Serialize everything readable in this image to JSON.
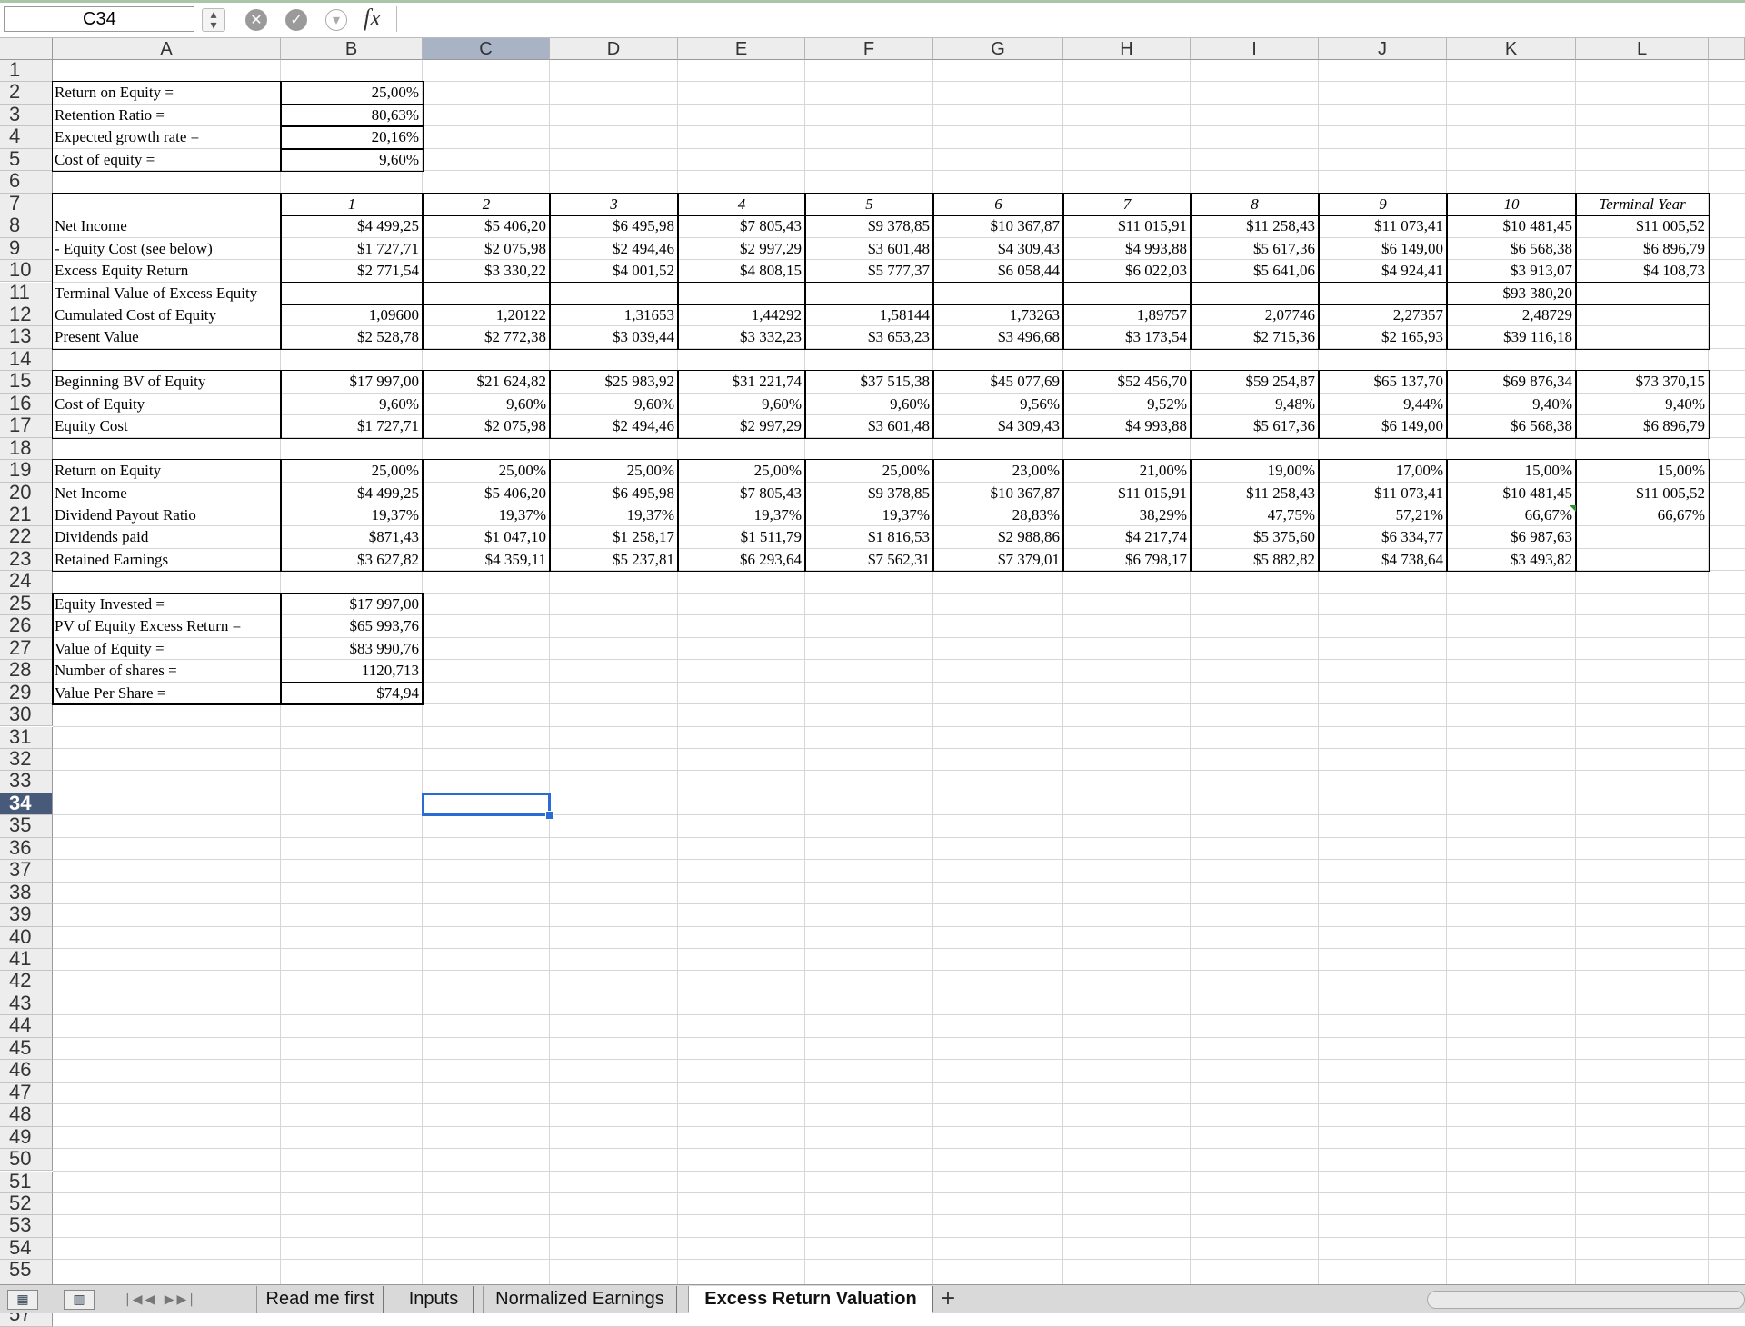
{
  "formula_bar": {
    "cell_ref": "C34",
    "fx": "fx",
    "formula": ""
  },
  "columns": [
    "A",
    "B",
    "C",
    "D",
    "E",
    "F",
    "G",
    "H",
    "I",
    "J",
    "K",
    "L"
  ],
  "selected_column": "C",
  "row_count": 57,
  "selected_row": 34,
  "assumptions": [
    {
      "label": "Return on Equity =",
      "value": "25,00%"
    },
    {
      "label": "Retention  Ratio =",
      "value": "80,63%"
    },
    {
      "label": "Expected growth rate =",
      "value": "20,16%"
    },
    {
      "label": "Cost of equity =",
      "value": "9,60%"
    }
  ],
  "years": [
    "1",
    "2",
    "3",
    "4",
    "5",
    "6",
    "7",
    "8",
    "9",
    "10",
    "Terminal Year"
  ],
  "table1": [
    {
      "label": "Net Income",
      "values": [
        "$4 499,25",
        "$5 406,20",
        "$6 495,98",
        "$7 805,43",
        "$9 378,85",
        "$10 367,87",
        "$11 015,91",
        "$11 258,43",
        "$11 073,41",
        "$10 481,45",
        "$11 005,52"
      ]
    },
    {
      "label": " - Equity Cost (see below)",
      "values": [
        "$1 727,71",
        "$2 075,98",
        "$2 494,46",
        "$2 997,29",
        "$3 601,48",
        "$4 309,43",
        "$4 993,88",
        "$5 617,36",
        "$6 149,00",
        "$6 568,38",
        "$6 896,79"
      ]
    },
    {
      "label": "Excess Equity Return",
      "values": [
        "$2 771,54",
        "$3 330,22",
        "$4 001,52",
        "$4 808,15",
        "$5 777,37",
        "$6 058,44",
        "$6 022,03",
        "$5 641,06",
        "$4 924,41",
        "$3 913,07",
        "$4 108,73"
      ]
    },
    {
      "label": "Terminal  Value of Excess Equity",
      "values": [
        "",
        "",
        "",
        "",
        "",
        "",
        "",
        "",
        "",
        "$93 380,20",
        ""
      ]
    },
    {
      "label": "Cumulated Cost of Equity",
      "values": [
        "1,09600",
        "1,20122",
        "1,31653",
        "1,44292",
        "1,58144",
        "1,73263",
        "1,89757",
        "2,07746",
        "2,27357",
        "2,48729",
        ""
      ]
    },
    {
      "label": "Present Value",
      "values": [
        "$2 528,78",
        "$2 772,38",
        "$3 039,44",
        "$3 332,23",
        "$3 653,23",
        "$3 496,68",
        "$3 173,54",
        "$2 715,36",
        "$2 165,93",
        "$39 116,18",
        ""
      ]
    }
  ],
  "table2": [
    {
      "label": "Beginning BV of Equity",
      "values": [
        "$17 997,00",
        "$21 624,82",
        "$25 983,92",
        "$31 221,74",
        "$37 515,38",
        "$45 077,69",
        "$52 456,70",
        "$59 254,87",
        "$65 137,70",
        "$69 876,34",
        "$73 370,15"
      ]
    },
    {
      "label": "Cost of Equity",
      "values": [
        "9,60%",
        "9,60%",
        "9,60%",
        "9,60%",
        "9,60%",
        "9,56%",
        "9,52%",
        "9,48%",
        "9,44%",
        "9,40%",
        "9,40%"
      ]
    },
    {
      "label": "Equity Cost",
      "values": [
        "$1 727,71",
        "$2 075,98",
        "$2 494,46",
        "$2 997,29",
        "$3 601,48",
        "$4 309,43",
        "$4 993,88",
        "$5 617,36",
        "$6 149,00",
        "$6 568,38",
        "$6 896,79"
      ]
    }
  ],
  "table3": [
    {
      "label": "Return on Equity",
      "values": [
        "25,00%",
        "25,00%",
        "25,00%",
        "25,00%",
        "25,00%",
        "23,00%",
        "21,00%",
        "19,00%",
        "17,00%",
        "15,00%",
        "15,00%"
      ]
    },
    {
      "label": "Net Income",
      "values": [
        "$4 499,25",
        "$5 406,20",
        "$6 495,98",
        "$7 805,43",
        "$9 378,85",
        "$10 367,87",
        "$11 015,91",
        "$11 258,43",
        "$11 073,41",
        "$10 481,45",
        "$11 005,52"
      ]
    },
    {
      "label": "Dividend Payout Ratio",
      "values": [
        "19,37%",
        "19,37%",
        "19,37%",
        "19,37%",
        "19,37%",
        "28,83%",
        "38,29%",
        "47,75%",
        "57,21%",
        "66,67%",
        "66,67%"
      ]
    },
    {
      "label": "Dividends paid",
      "values": [
        "$871,43",
        "$1 047,10",
        "$1 258,17",
        "$1 511,79",
        "$1 816,53",
        "$2 988,86",
        "$4 217,74",
        "$5 375,60",
        "$6 334,77",
        "$6 987,63",
        ""
      ]
    },
    {
      "label": "Retained Earnings",
      "values": [
        "$3 627,82",
        "$4 359,11",
        "$5 237,81",
        "$6 293,64",
        "$7 562,31",
        "$7 379,01",
        "$6 798,17",
        "$5 882,82",
        "$4 738,64",
        "$3 493,82",
        ""
      ]
    }
  ],
  "summary": [
    {
      "label": "Equity Invested =",
      "value": "$17 997,00"
    },
    {
      "label": "PV of Equity Excess Return =",
      "value": "$65 993,76"
    },
    {
      "label": "Value of Equity =",
      "value": "$83 990,76"
    },
    {
      "label": "Number of shares =",
      "value": "1120,713"
    },
    {
      "label": "Value Per Share =",
      "value": "$74,94"
    }
  ],
  "sheet_tabs": [
    "Read me first",
    "Inputs",
    "Normalized Earnings",
    "Excess Return Valuation"
  ],
  "active_tab": "Excess Return Valuation"
}
